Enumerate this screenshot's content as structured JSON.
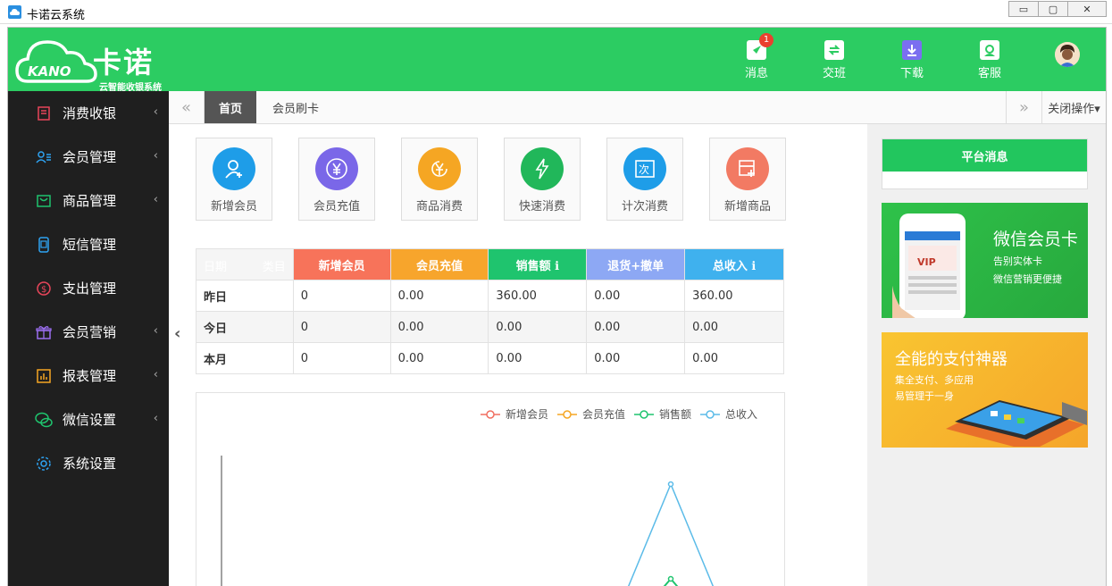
{
  "window": {
    "title": "卡诺云系统",
    "min": "▭",
    "max": "▢",
    "close": "✕"
  },
  "logo": {
    "name": "卡诺",
    "subtitle": "云智能收银系统",
    "mark": "KANO"
  },
  "header_nav": [
    {
      "label": "消息",
      "icon": "rocket-icon",
      "badge": "1"
    },
    {
      "label": "交班",
      "icon": "swap-icon"
    },
    {
      "label": "下载",
      "icon": "download-icon"
    },
    {
      "label": "客服",
      "icon": "support-icon"
    }
  ],
  "sidebar": {
    "items": [
      {
        "label": "消费收银",
        "icon": "cashier-icon",
        "expandable": true
      },
      {
        "label": "会员管理",
        "icon": "members-icon",
        "expandable": true
      },
      {
        "label": "商品管理",
        "icon": "goods-icon",
        "expandable": true
      },
      {
        "label": "短信管理",
        "icon": "sms-icon",
        "expandable": false
      },
      {
        "label": "支出管理",
        "icon": "expense-icon",
        "expandable": false
      },
      {
        "label": "会员营销",
        "icon": "gift-icon",
        "expandable": true
      },
      {
        "label": "报表管理",
        "icon": "report-icon",
        "expandable": true
      },
      {
        "label": "微信设置",
        "icon": "wechat-icon",
        "expandable": true
      },
      {
        "label": "系统设置",
        "icon": "settings-icon",
        "expandable": false
      }
    ]
  },
  "tabs": {
    "prev": "«",
    "home": "首页",
    "card": "会员刷卡",
    "next": "»",
    "close_ops": "关闭操作▾"
  },
  "quick_actions": [
    {
      "label": "新增会员",
      "color": "#1e9de8",
      "glyph": "👤"
    },
    {
      "label": "会员充值",
      "color": "#7a67e8",
      "glyph": "¥"
    },
    {
      "label": "商品消费",
      "color": "#f5a623",
      "glyph": "¥"
    },
    {
      "label": "快速消费",
      "color": "#21b75a",
      "glyph": "⚡"
    },
    {
      "label": "计次消费",
      "color": "#1e9de8",
      "glyph": "次"
    },
    {
      "label": "新增商品",
      "color": "#f27a63",
      "glyph": "+"
    }
  ],
  "stats": {
    "corner_left": "日期",
    "corner_right": "类目",
    "columns": [
      {
        "label": "新增会员",
        "color": "#f7735a"
      },
      {
        "label": "会员充值",
        "color": "#f7a52c"
      },
      {
        "label": "销售额 ℹ",
        "color": "#1fc46e"
      },
      {
        "label": "退货+撤单",
        "color": "#8da8f4"
      },
      {
        "label": "总收入 ℹ",
        "color": "#3fb1ee"
      }
    ],
    "rows": [
      {
        "label": "昨日",
        "values": [
          "0",
          "0.00",
          "360.00",
          "0.00",
          "360.00"
        ]
      },
      {
        "label": "今日",
        "values": [
          "0",
          "0.00",
          "0.00",
          "0.00",
          "0.00"
        ]
      },
      {
        "label": "本月",
        "values": [
          "0",
          "0.00",
          "0.00",
          "0.00",
          "0.00"
        ]
      }
    ]
  },
  "chart_data": {
    "type": "line",
    "series": [
      {
        "name": "新增会员",
        "color": "#f06e60"
      },
      {
        "name": "会员充值",
        "color": "#f5a623"
      },
      {
        "name": "销售额",
        "color": "#1fc46e"
      },
      {
        "name": "总收入",
        "color": "#5bbbe8"
      }
    ],
    "legend_position": "top-right"
  },
  "right_panel": {
    "notice_title": "平台消息",
    "banner1": {
      "title": "微信会员卡",
      "line1": "告别实体卡",
      "line2": "微信营销更便捷",
      "badge": "VIP"
    },
    "banner2": {
      "title": "全能的支付神器",
      "line1": "集全支付、多应用",
      "line2": "易管理于一身"
    }
  }
}
